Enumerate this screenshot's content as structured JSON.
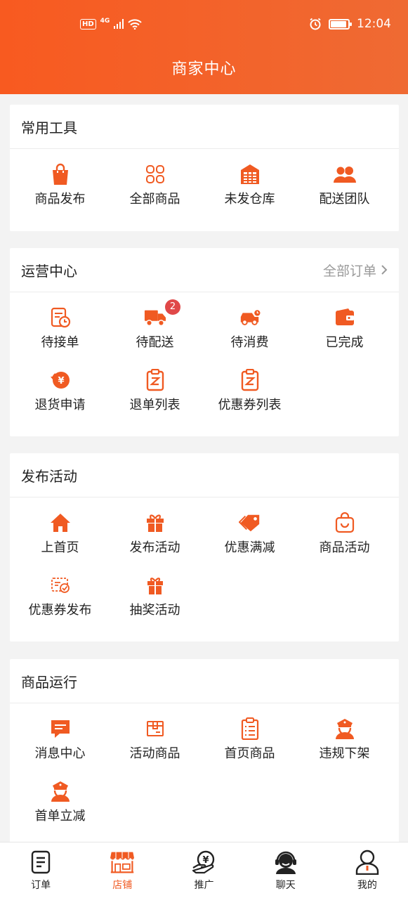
{
  "status_bar": {
    "network": "4G",
    "hd": "HD",
    "time": "12:04"
  },
  "header": {
    "title": "商家中心"
  },
  "accent": "#f05a22",
  "sections": {
    "tools": {
      "title": "常用工具",
      "items": [
        {
          "label": "商品发布",
          "icon": "shopping-bag-icon"
        },
        {
          "label": "全部商品",
          "icon": "grid-icon"
        },
        {
          "label": "未发仓库",
          "icon": "warehouse-icon"
        },
        {
          "label": "配送团队",
          "icon": "team-icon"
        }
      ]
    },
    "ops": {
      "title": "运营中心",
      "link": "全部订单",
      "items": [
        {
          "label": "待接单",
          "icon": "receipt-clock-icon"
        },
        {
          "label": "待配送",
          "icon": "truck-icon",
          "badge": "2"
        },
        {
          "label": "待消费",
          "icon": "delivery-car-icon"
        },
        {
          "label": "已完成",
          "icon": "wallet-icon"
        },
        {
          "label": "退货申请",
          "icon": "refund-icon"
        },
        {
          "label": "退单列表",
          "icon": "clipboard-list-icon"
        },
        {
          "label": "优惠券列表",
          "icon": "coupon-list-icon"
        }
      ]
    },
    "activity": {
      "title": "发布活动",
      "items": [
        {
          "label": "上首页",
          "icon": "home-icon"
        },
        {
          "label": "发布活动",
          "icon": "gift-icon"
        },
        {
          "label": "优惠满减",
          "icon": "tag-icon"
        },
        {
          "label": "商品活动",
          "icon": "basket-icon"
        },
        {
          "label": "优惠券发布",
          "icon": "coupon-check-icon"
        },
        {
          "label": "抽奖活动",
          "icon": "lottery-gift-icon"
        }
      ]
    },
    "goods": {
      "title": "商品运行",
      "items": [
        {
          "label": "消息中心",
          "icon": "message-icon"
        },
        {
          "label": "活动商品",
          "icon": "box-icon"
        },
        {
          "label": "首页商品",
          "icon": "clipboard-icon"
        },
        {
          "label": "违规下架",
          "icon": "police-icon"
        },
        {
          "label": "首单立减",
          "icon": "police-icon"
        }
      ]
    }
  },
  "tabbar": [
    {
      "label": "订单",
      "icon": "document-icon",
      "active": false
    },
    {
      "label": "店铺",
      "icon": "storefront-icon",
      "active": true
    },
    {
      "label": "推广",
      "icon": "yuan-hand-icon",
      "active": false
    },
    {
      "label": "聊天",
      "icon": "headset-icon",
      "active": false
    },
    {
      "label": "我的",
      "icon": "user-icon",
      "active": false
    }
  ]
}
